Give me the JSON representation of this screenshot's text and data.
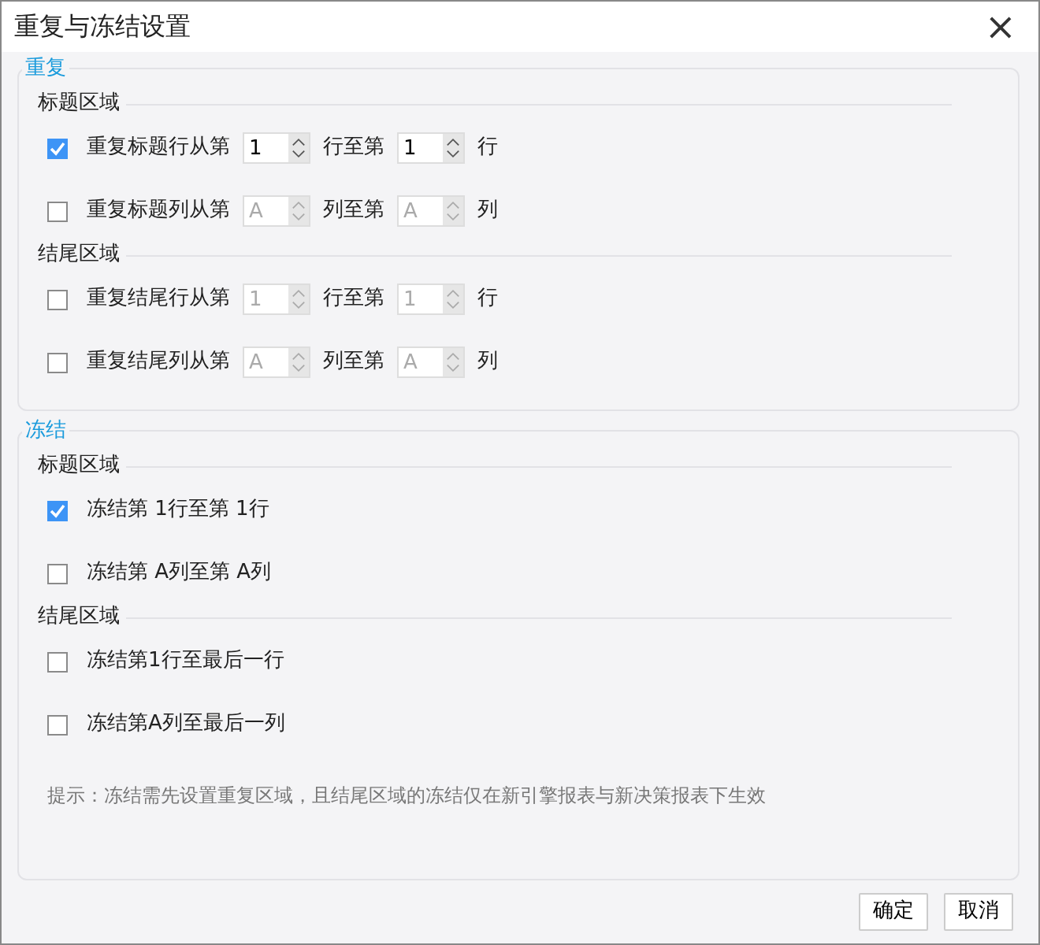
{
  "window": {
    "title": "重复与冻结设置",
    "close": "×"
  },
  "repeat": {
    "title": "重复",
    "groups": [
      {
        "title": "标题区域",
        "rows": [
          {
            "checked": true,
            "label": "重复标题行从第",
            "from": "1",
            "middle": "行至第",
            "to": "1",
            "unit": "行"
          },
          {
            "checked": false,
            "label": "重复标题列从第",
            "from": "A",
            "middle": "列至第",
            "to": "A",
            "unit": "列"
          }
        ]
      },
      {
        "title": "结尾区域",
        "rows": [
          {
            "checked": false,
            "label": "重复结尾行从第",
            "from": "1",
            "middle": "行至第",
            "to": "1",
            "unit": "行"
          },
          {
            "checked": false,
            "label": "重复结尾列从第",
            "from": "A",
            "middle": "列至第",
            "to": "A",
            "unit": "列"
          }
        ]
      }
    ]
  },
  "freeze": {
    "title": "冻结",
    "groups": [
      {
        "title": "标题区域",
        "rows": [
          {
            "checked": true,
            "label": "冻结第 1行至第 1行"
          },
          {
            "checked": false,
            "label": "冻结第 A列至第 A列"
          }
        ]
      },
      {
        "title": "结尾区域",
        "rows": [
          {
            "checked": false,
            "label": "冻结第1行至最后一行"
          },
          {
            "checked": false,
            "label": "冻结第A列至最后一列"
          }
        ]
      }
    ],
    "hint": "提示：冻结需先设置重复区域，且结尾区域的冻结仅在新引擎报表与新决策报表下生效"
  },
  "buttons": [
    "确定",
    "取消"
  ]
}
